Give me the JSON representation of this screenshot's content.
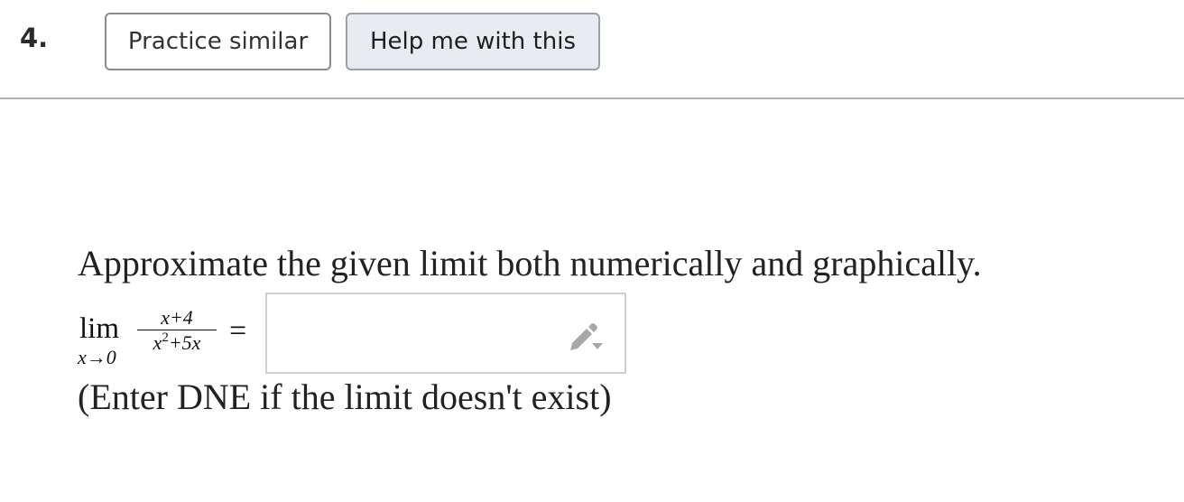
{
  "question": {
    "number": "4.",
    "practice_label": "Practice similar",
    "help_label": "Help me with this"
  },
  "problem": {
    "prompt": "Approximate the given limit both numerically and graphically.",
    "limit_word": "lim",
    "limit_sub": "x→0",
    "numerator": "x+4",
    "denominator_base": "x",
    "denominator_exp": "2",
    "denominator_rest": "+5x",
    "equals": "=",
    "answer_value": "",
    "note": "(Enter DNE if the limit doesn't exist)"
  },
  "icons": {
    "answer_tool": "pencil-dropdown-icon"
  },
  "colors": {
    "help_button_bg": "#e8ebf0",
    "divider": "#b3b3b3",
    "answer_border": "#cfcfcf",
    "pencil_icon": "#a8a8a8"
  }
}
